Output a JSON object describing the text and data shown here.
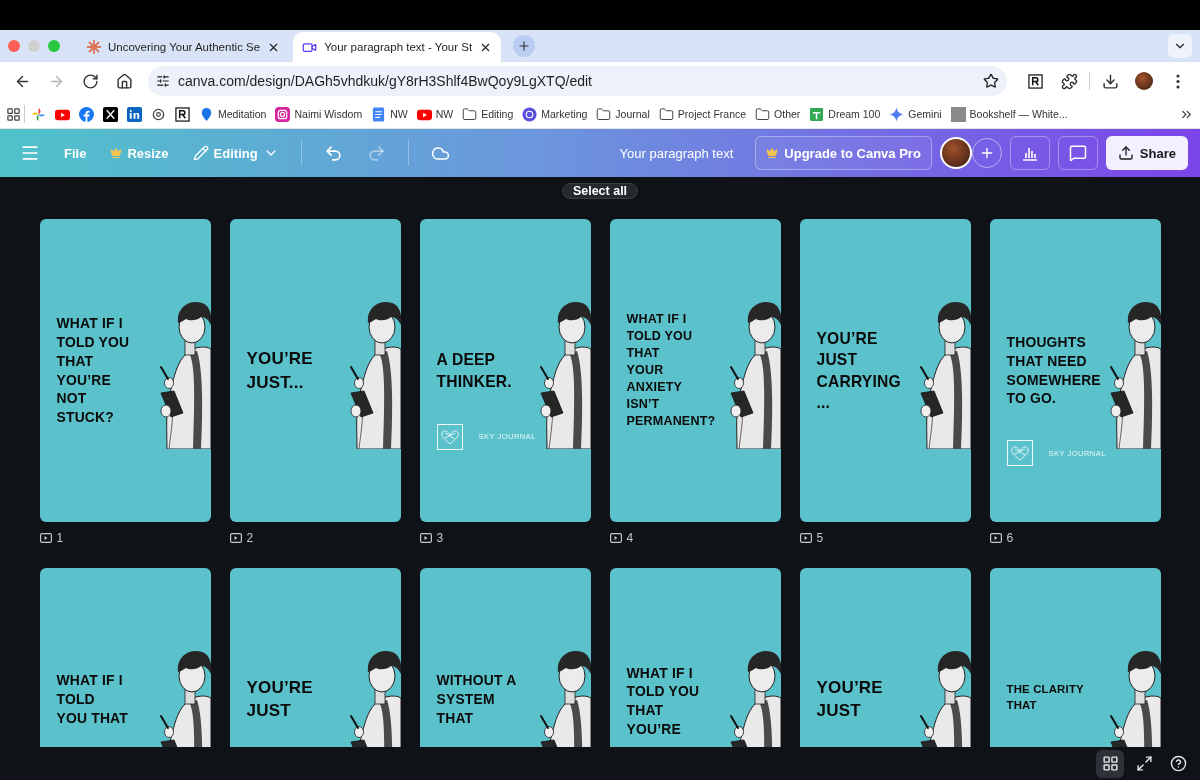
{
  "browser": {
    "tabs": [
      {
        "title": "Uncovering Your Authentic Se",
        "kind": "asterisk",
        "selected": false
      },
      {
        "title": "Your paragraph text - Your St",
        "kind": "video",
        "selected": true
      }
    ],
    "nav_buttons": [
      {
        "kind": "back",
        "disabled": false
      },
      {
        "kind": "forward",
        "disabled": true
      },
      {
        "kind": "reload",
        "disabled": false
      },
      {
        "kind": "home",
        "disabled": false
      }
    ],
    "url": "canva.com/design/DAGh5vhdkuk/gY8rH3Shlf4BwQoy9LgXTQ/edit",
    "bookmarks": [
      {
        "kind": "pinwheel"
      },
      {
        "kind": "youtube"
      },
      {
        "kind": "facebook"
      },
      {
        "kind": "x"
      },
      {
        "kind": "linkedin"
      },
      {
        "kind": "threads"
      },
      {
        "kind": "r"
      },
      {
        "kind": "pin",
        "label": "Meditation"
      },
      {
        "kind": "instagram",
        "label": "Naimi Wisdom"
      },
      {
        "kind": "docs",
        "label": "NW"
      },
      {
        "kind": "youtube",
        "label": "NW"
      },
      {
        "kind": "folder",
        "label": "Editing"
      },
      {
        "kind": "badge",
        "label": "Marketing"
      },
      {
        "kind": "folder",
        "label": "Journal"
      },
      {
        "kind": "folder",
        "label": "Project France"
      },
      {
        "kind": "folder",
        "label": "Other"
      },
      {
        "kind": "sheets",
        "label": "Dream 100"
      },
      {
        "kind": "gemini",
        "label": "Gemini"
      },
      {
        "kind": "square",
        "label": "Bookshelf — White..."
      }
    ]
  },
  "editor": {
    "menu": [
      {
        "kind": "file",
        "label": "File"
      },
      {
        "kind": "resize",
        "label": "Resize"
      },
      {
        "kind": "editing",
        "label": "Editing"
      }
    ],
    "history": [
      {
        "kind": "undo",
        "disabled": false
      },
      {
        "kind": "redo",
        "disabled": true
      }
    ],
    "title": "Your paragraph text",
    "upgrade": "Upgrade to Canva Pro",
    "share": "Share",
    "tooltip": "Select all"
  },
  "slides": [
    {
      "number": "1",
      "text": "WHAT IF I\nTOLD YOU\nTHAT\nYOU’RE\nNOT\nSTUCK?"
    },
    {
      "number": "2",
      "text": "YOU’RE\nJUST..."
    },
    {
      "number": "3",
      "text": "A DEEP\nTHINKER.",
      "logo": "SKY JOURNAL"
    },
    {
      "number": "4",
      "text": "WHAT IF I\nTOLD YOU\nTHAT\nYOUR\nANXIETY\nISN’T\nPERMANENT?"
    },
    {
      "number": "5",
      "text": "YOU’RE\nJUST\nCARRYING\n..."
    },
    {
      "number": "6",
      "text": "THOUGHTS\nTHAT NEED\nSOMEWHERE\nTO GO.",
      "logo": "SKY JOURNAL"
    },
    {
      "text": "WHAT IF I\nTOLD\nYOU THAT"
    },
    {
      "text": "YOU’RE\nJUST"
    },
    {
      "text": "WITHOUT A\nSYSTEM\nTHAT"
    },
    {
      "text": "WHAT IF I\nTOLD YOU\nTHAT\nYOU’RE"
    },
    {
      "text": "YOU’RE\nJUST"
    },
    {
      "text": "THE CLARITY\nTHAT"
    }
  ],
  "footer": [
    {
      "kind": "grid",
      "selected": true
    },
    {
      "kind": "fullscreen",
      "selected": false
    },
    {
      "kind": "help",
      "selected": false
    }
  ]
}
